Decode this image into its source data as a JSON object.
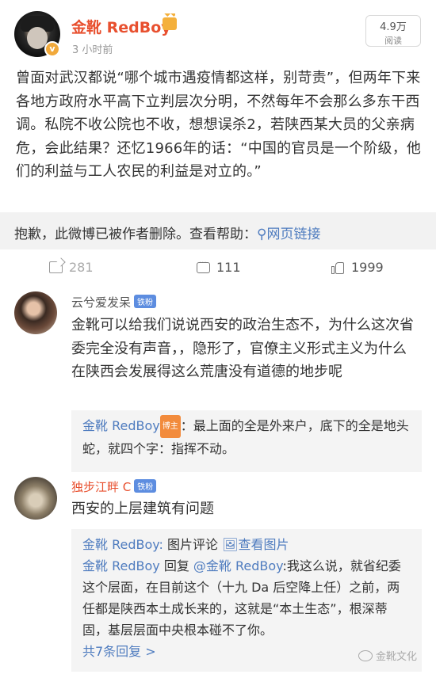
{
  "post": {
    "author": "金靴 RedBoy",
    "time": "3 小时前",
    "reads_count": "4.9万",
    "reads_label": "阅读",
    "body": "曾面对武汉都说“哪个城市遇疫情都这样，别苛责”，但两年下来各地方政府水平高下立判层次分明，不然每年不会那么多东干西调。私院不收公院也不收，想想误杀2，若陕西某大员的父亲病危，会此结果？还忆1966年的话：“中国的官员是一个阶级，他们的利益与工人农民的利益是对立的。”",
    "deleted_notice": "抱歉，此微博已被作者删除。查看帮助：",
    "help_link": "网页链接",
    "reposts": "281",
    "comments": "111",
    "likes": "1999"
  },
  "comments": [
    {
      "name": "云兮爱发呆",
      "badge": "铁粉",
      "text": "金靴可以给我们说说西安的政治生态不，为什么这次省委完全没有声音，，隐形了，官僚主义形式主义为什么在陕西会发展得这么荒唐没有道德的地步呢",
      "reply_author": "金靴 RedBoy",
      "reply_badge": "博主",
      "reply_text": "：最上面的全是外来户，底下的全是地头蛇，就四个字：指挥不动。"
    },
    {
      "name": "独步江畔 C",
      "badge": "铁粉",
      "text": "西安的上层建筑有问题",
      "reply1_author": "金靴 RedBoy:",
      "reply1_text": " 图片评论 ",
      "reply1_link": "查看图片",
      "reply2_author": "金靴 RedBoy",
      "reply2_mid": " 回复 ",
      "reply2_target": "@金靴 RedBoy",
      "reply2_text": ":我这么说，就省纪委这个层面，在目前这个（十九 Da 后空降上任）之前，两任都是陕西本土成长来的，这就是“本土生态”，根深蒂固，基层层面中央根本碰不了你。",
      "more": "共7条回复 >"
    }
  ],
  "watermark": "金靴文化",
  "colors": {
    "accent": "#e8502f",
    "link": "#4f7cbf",
    "gold": "#f1a93b"
  }
}
